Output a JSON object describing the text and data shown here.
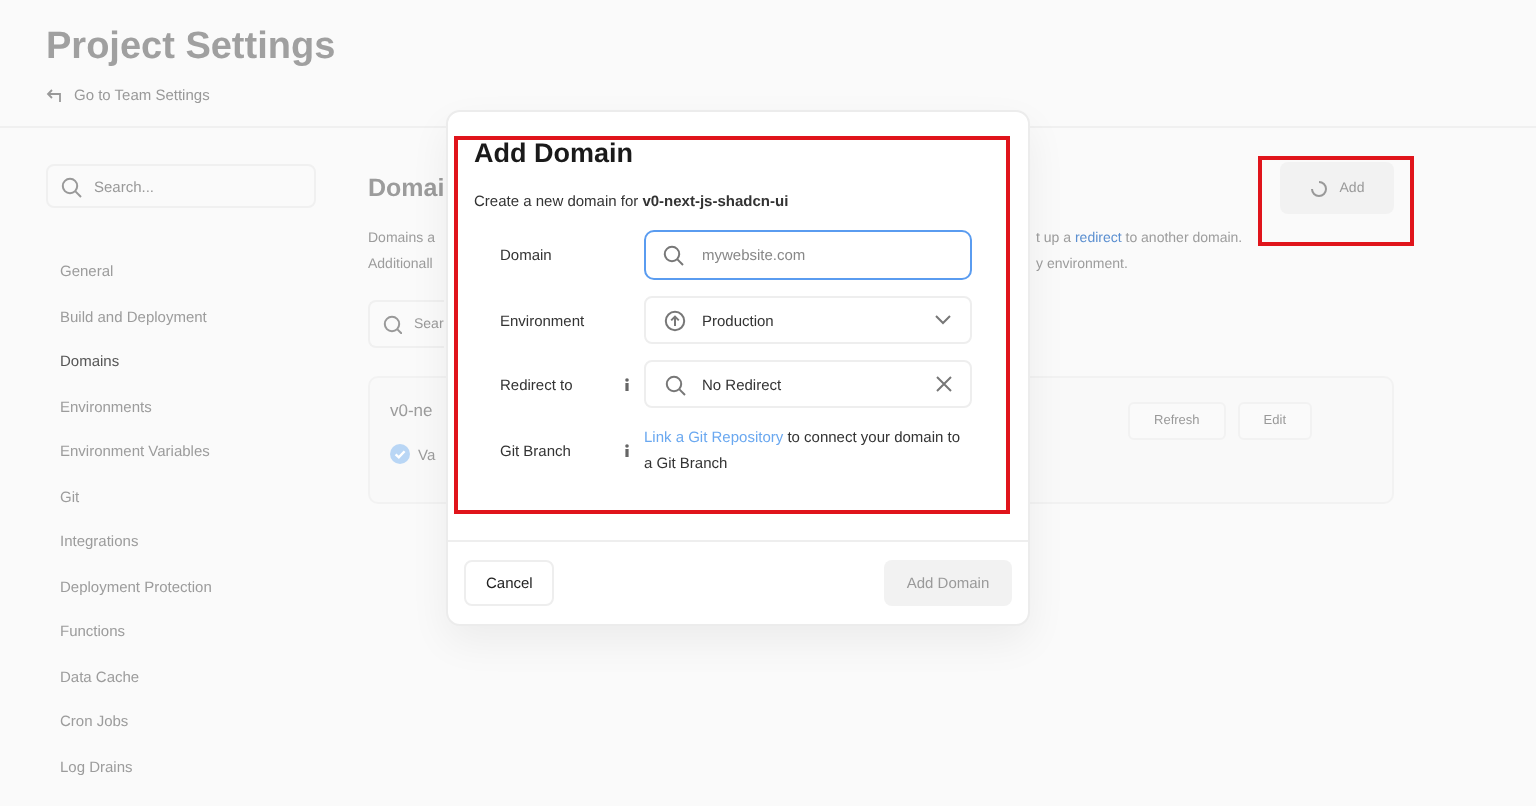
{
  "page": {
    "title": "Project Settings",
    "back_link": "Go to Team Settings"
  },
  "sidebar": {
    "search": {
      "placeholder": "Search..."
    },
    "items": [
      {
        "label": "General",
        "selected": false
      },
      {
        "label": "Build and Deployment",
        "selected": false
      },
      {
        "label": "Domains",
        "selected": true
      },
      {
        "label": "Environments",
        "selected": false
      },
      {
        "label": "Environment Variables",
        "selected": false
      },
      {
        "label": "Git",
        "selected": false
      },
      {
        "label": "Integrations",
        "selected": false
      },
      {
        "label": "Deployment Protection",
        "selected": false
      },
      {
        "label": "Functions",
        "selected": false
      },
      {
        "label": "Data Cache",
        "selected": false
      },
      {
        "label": "Cron Jobs",
        "selected": false
      },
      {
        "label": "Log Drains",
        "selected": false
      }
    ]
  },
  "main": {
    "title": "Domai",
    "add_button": "Add",
    "description_left": [
      "Domains a",
      "Additionall"
    ],
    "description_right": [
      {
        "before": "t up a ",
        "link": "redirect",
        "after": " to another domain."
      },
      {
        "before": "y environment."
      }
    ],
    "search": {
      "placeholder": "Sear"
    },
    "domain_card": {
      "name": "v0-ne",
      "status": "Va",
      "buttons": [
        "Refresh",
        "Edit"
      ]
    }
  },
  "dialog": {
    "title": "Add Domain",
    "subtitle": "Create a new domain for **v0-next-js-shadcn-ui**",
    "fields": [
      {
        "kind": "input",
        "label": "Domain",
        "placeholder": "mywebsite.com",
        "focused": true
      },
      {
        "kind": "select",
        "label": "Environment",
        "value": "Production"
      },
      {
        "kind": "search-select",
        "label": "Redirect to",
        "info": true,
        "value": "No Redirect"
      },
      {
        "kind": "link-text",
        "label": "Git Branch",
        "info": true,
        "link": "Link a Git Repository",
        "text": " to connect your domain to a Git Branch"
      }
    ],
    "cancel": "Cancel",
    "submit": {
      "label": "Add Domain",
      "disabled": true
    }
  }
}
